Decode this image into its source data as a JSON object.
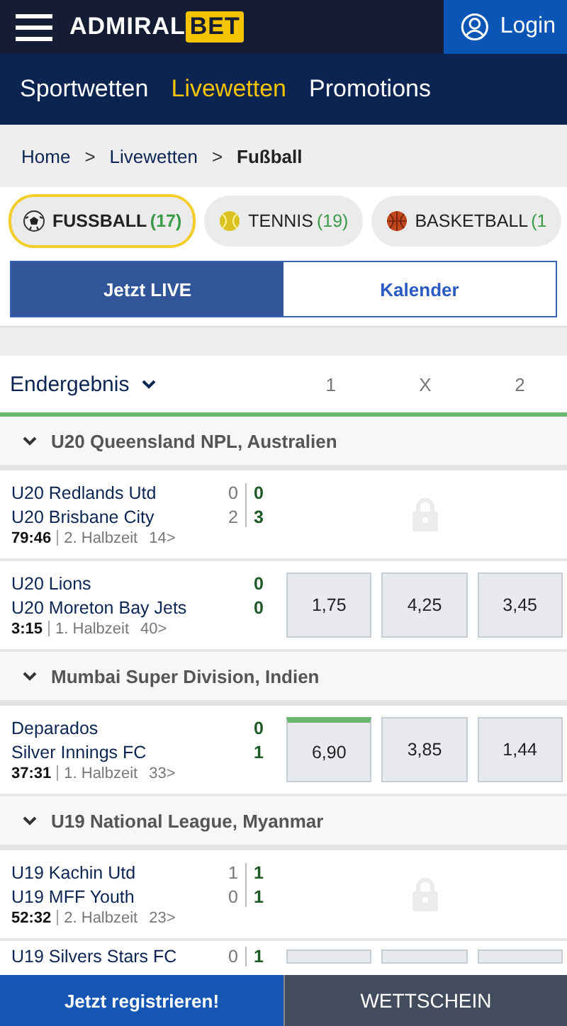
{
  "header": {
    "logo_left": "ADMIRAL",
    "logo_right": "BET",
    "login": "Login"
  },
  "nav": [
    {
      "label": "Sportwetten",
      "selected": false
    },
    {
      "label": "Livewetten",
      "selected": true
    },
    {
      "label": "Promotions",
      "selected": false
    }
  ],
  "breadcrumb": [
    {
      "label": "Home",
      "current": false
    },
    {
      "label": "Livewetten",
      "current": false
    },
    {
      "label": "Fußball",
      "current": true
    }
  ],
  "breadcrumb_separator": ">",
  "sports": [
    {
      "kind": "football",
      "name": "FUSSBALL",
      "count": "(17)",
      "selected": true
    },
    {
      "kind": "tennis",
      "name": "TENNIS",
      "count": "(19)",
      "selected": false
    },
    {
      "kind": "basketball",
      "name": "BASKETBALL",
      "count": "(1",
      "selected": false
    }
  ],
  "view_tabs": [
    {
      "label": "Jetzt LIVE",
      "selected": true
    },
    {
      "label": "Kalender",
      "selected": false
    }
  ],
  "market": {
    "label": "Endergebnis",
    "columns": [
      "1",
      "X",
      "2"
    ]
  },
  "leagues": [
    {
      "name": "U20 Queensland NPL, Australien",
      "matches": [
        {
          "home": "U20 Redlands Utd",
          "away": "U20 Brisbane City",
          "home_period": "0",
          "away_period": "2",
          "home_score": "0",
          "away_score": "3",
          "time": "79:46",
          "phase": "2. Halbzeit",
          "markets": "14>",
          "locked": true
        },
        {
          "home": "U20 Lions",
          "away": "U20 Moreton Bay Jets",
          "home_score": "0",
          "away_score": "0",
          "time": "3:15",
          "phase": "1. Halbzeit",
          "markets": "40>",
          "locked": false,
          "odds": [
            {
              "value": "1,75",
              "selected": false
            },
            {
              "value": "4,25",
              "selected": false
            },
            {
              "value": "3,45",
              "selected": false
            }
          ]
        }
      ]
    },
    {
      "name": "Mumbai Super Division, Indien",
      "matches": [
        {
          "home": "Deparados",
          "away": "Silver Innings FC",
          "home_score": "0",
          "away_score": "1",
          "time": "37:31",
          "phase": "1. Halbzeit",
          "markets": "33>",
          "locked": false,
          "odds": [
            {
              "value": "6,90",
              "selected": true
            },
            {
              "value": "3,85",
              "selected": false
            },
            {
              "value": "1,44",
              "selected": false
            }
          ]
        }
      ]
    },
    {
      "name": "U19 National League, Myanmar",
      "matches": [
        {
          "home": "U19 Kachin Utd",
          "away": "U19 MFF Youth",
          "home_period": "1",
          "away_period": "0",
          "home_score": "1",
          "away_score": "1",
          "time": "52:32",
          "phase": "2. Halbzeit",
          "markets": "23>",
          "locked": true
        },
        {
          "home": "U19 Silvers Stars FC",
          "home_period": "0",
          "home_score": "1",
          "locked": false,
          "odds": [
            {
              "selected": false
            },
            {
              "selected": false
            },
            {
              "selected": false
            }
          ]
        }
      ]
    }
  ],
  "footer": {
    "register": "Jetzt registrieren!",
    "betslip": "WETTSCHEIN"
  }
}
